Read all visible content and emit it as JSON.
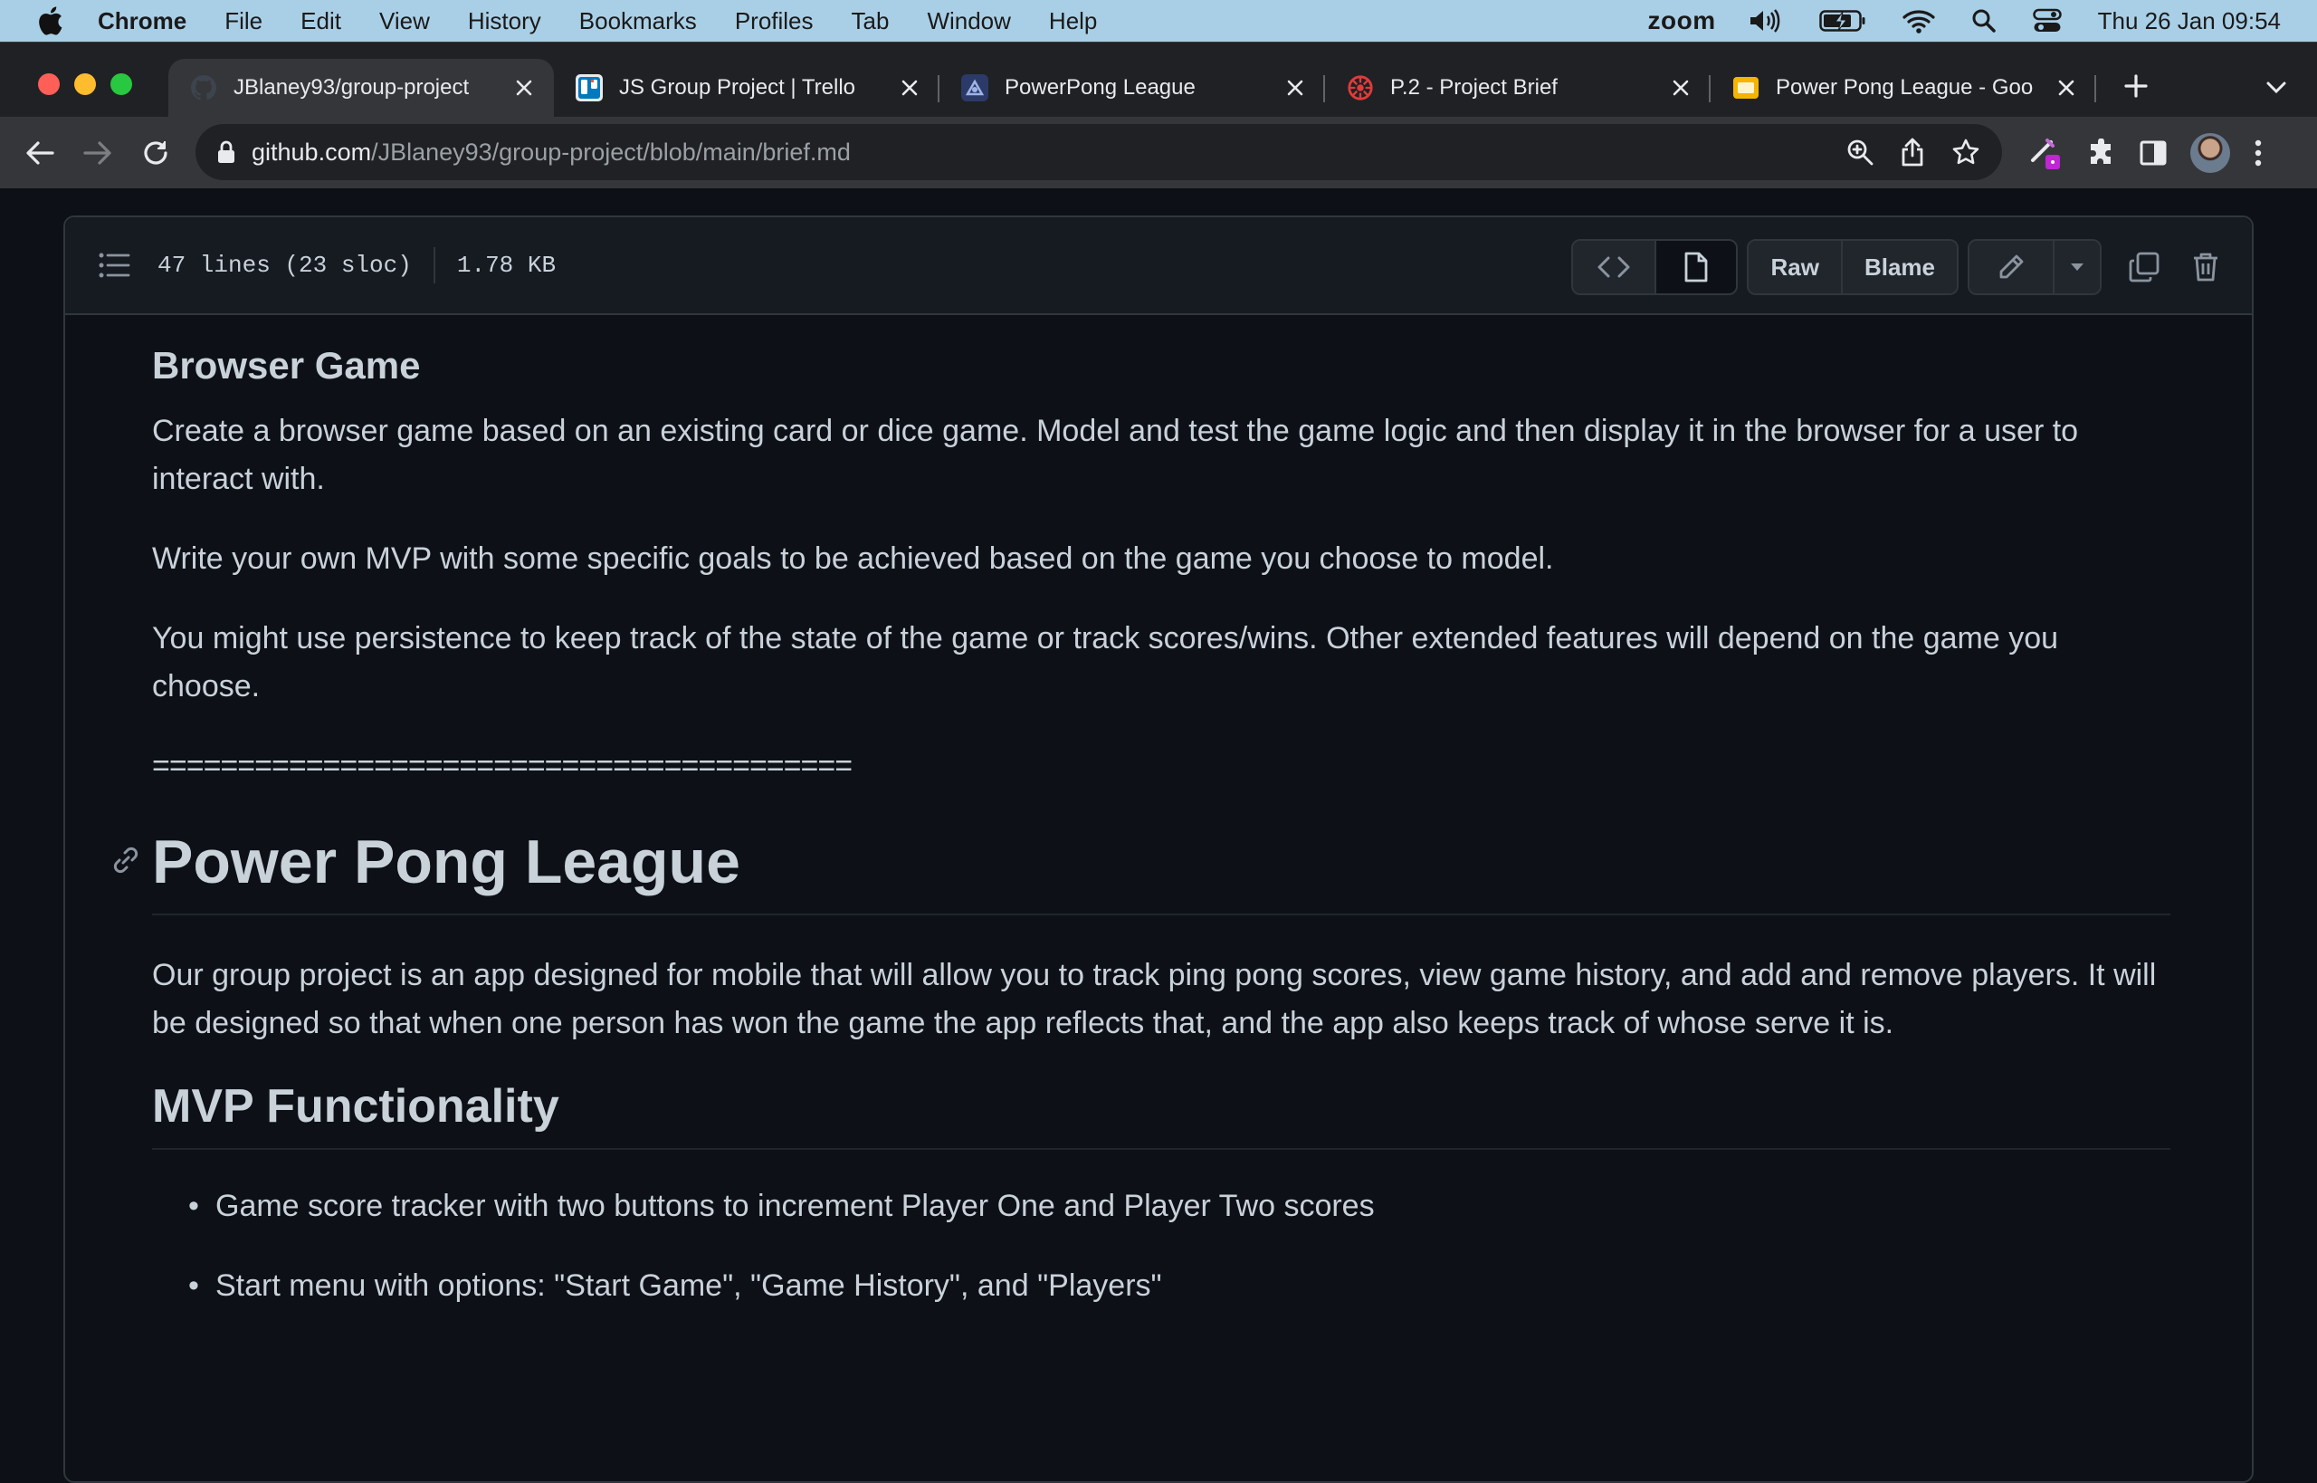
{
  "menubar": {
    "app_name": "Chrome",
    "items": [
      "File",
      "Edit",
      "View",
      "History",
      "Bookmarks",
      "Profiles",
      "Tab",
      "Window",
      "Help"
    ],
    "zoom_label": "zoom",
    "clock": "Thu 26 Jan  09:54",
    "icons": [
      "apple-icon",
      "volume-icon",
      "battery-icon",
      "wifi-icon",
      "spotlight-icon",
      "control-center-icon"
    ]
  },
  "browser": {
    "tabs": [
      {
        "title": "JBlaney93/group-project",
        "favicon": "github-icon",
        "active": true
      },
      {
        "title": "JS Group Project | Trello",
        "favicon": "trello-icon",
        "active": false
      },
      {
        "title": "PowerPong League",
        "favicon": "app-icon",
        "active": false
      },
      {
        "title": "P.2 - Project Brief",
        "favicon": "codeclan-icon",
        "active": false
      },
      {
        "title": "Power Pong League - Goo",
        "favicon": "google-slides-icon",
        "active": false
      }
    ],
    "url_host": "github.com",
    "url_path": "/JBlaney93/group-project/blob/main/brief.md",
    "colors": {
      "menubar": "#a9cfe6",
      "frame": "#202124",
      "toolbar": "#35363a",
      "github_bg": "#0d1117"
    }
  },
  "file": {
    "lines_info": "47 lines (23 sloc)",
    "size": "1.78 KB",
    "raw_label": "Raw",
    "blame_label": "Blame"
  },
  "content": {
    "h3": "Browser Game",
    "p1": "Create a browser game based on an existing card or dice game. Model and test the game logic and then display it in the browser for a user to interact with.",
    "p2": "Write your own MVP with some specific goals to be achieved based on the game you choose to model.",
    "p3": "You might use persistence to keep track of the state of the game or track scores/wins. Other extended features will depend on the game you choose.",
    "separator": "=========================================",
    "h1": "Power Pong League",
    "p4": "Our group project is an app designed for mobile that will allow you to track ping pong scores, view game history, and add and remove players. It will be designed so that when one person has won the game the app reflects that, and the app also keeps track of whose serve it is.",
    "h2": "MVP Functionality",
    "list": [
      "Game score tracker with two buttons to increment Player One and Player Two scores",
      "Start menu with options: \"Start Game\", \"Game History\", and \"Players\""
    ]
  }
}
